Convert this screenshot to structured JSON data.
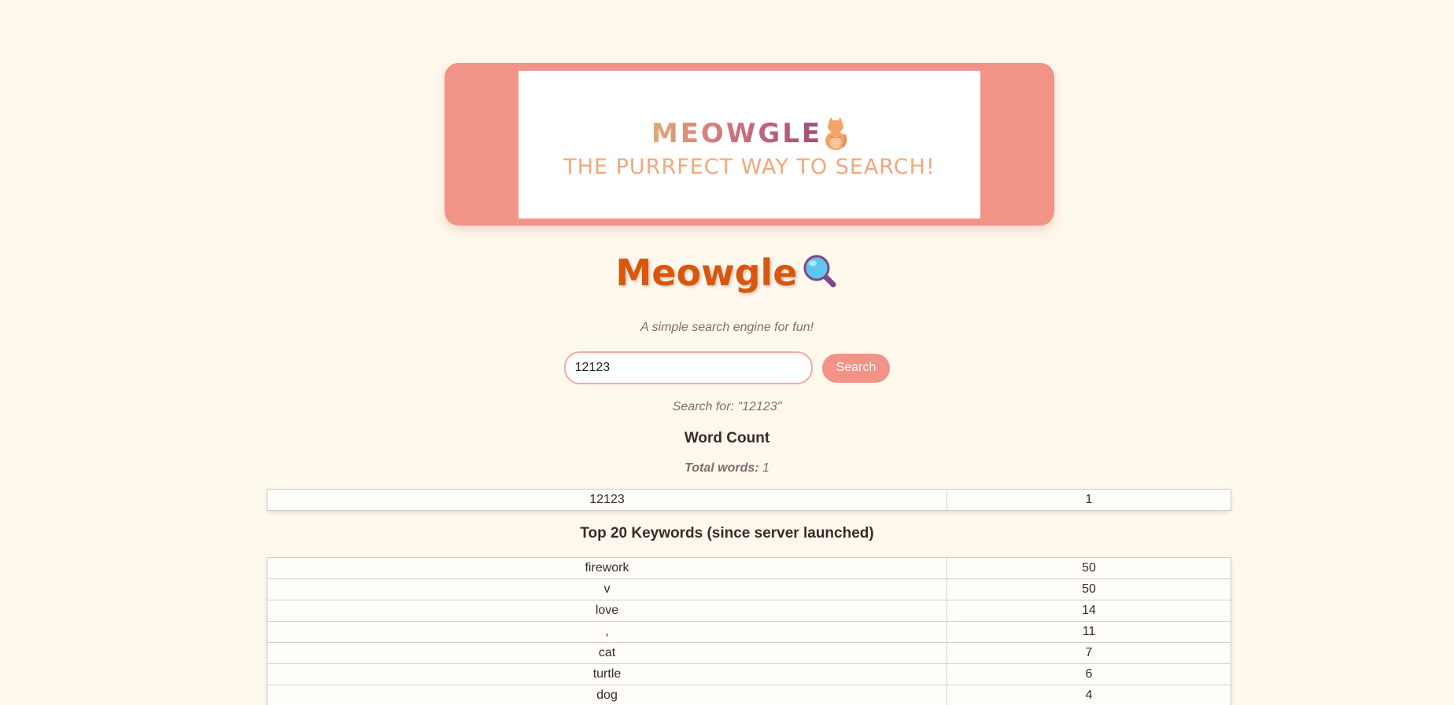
{
  "banner": {
    "logo_text": "MEOWGLE",
    "tagline": "THE PURRFECT WAY TO SEARCH!"
  },
  "header": {
    "title": "Meowgle",
    "title_icon": "magnifying-glass-icon",
    "subtitle": "A simple search engine for fun!"
  },
  "search": {
    "value": "12123",
    "button_label": "Search",
    "search_for": "Search for: \"12123\""
  },
  "word_count": {
    "heading": "Word Count",
    "total_label": "Total words:",
    "total_value": "1",
    "rows": [
      {
        "word": "12123",
        "count": "1"
      }
    ]
  },
  "keywords": {
    "heading": "Top 20 Keywords (since server launched)",
    "rows": [
      {
        "word": "firework",
        "count": "50"
      },
      {
        "word": "v",
        "count": "50"
      },
      {
        "word": "love",
        "count": "14"
      },
      {
        "word": ",",
        "count": "11"
      },
      {
        "word": "cat",
        "count": "7"
      },
      {
        "word": "turtle",
        "count": "6"
      },
      {
        "word": "dog",
        "count": "4"
      }
    ]
  },
  "colors": {
    "background": "#fff8ec",
    "accent": "#f29388",
    "title": "#d9570d"
  }
}
